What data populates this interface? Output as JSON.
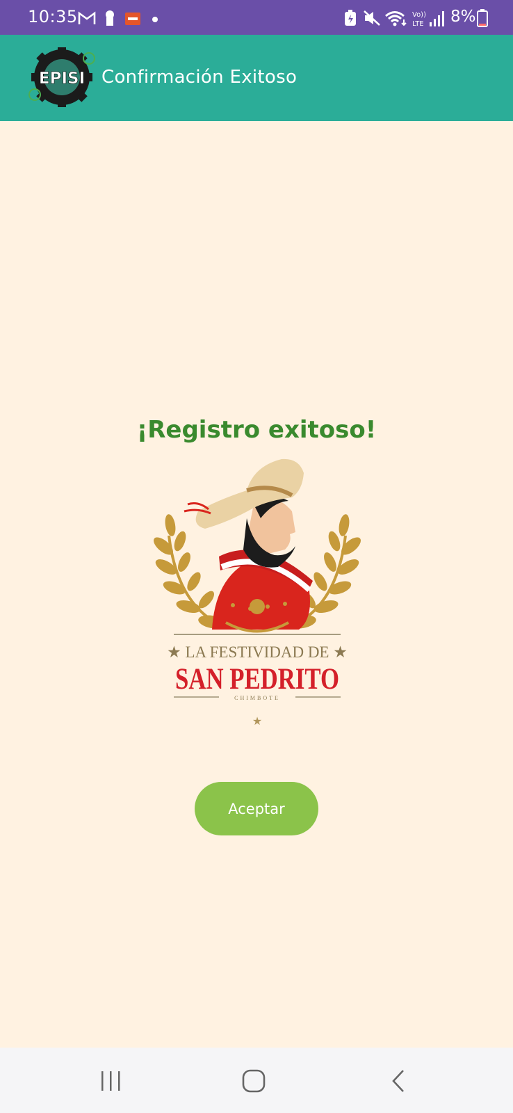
{
  "status_bar": {
    "time": "10:35",
    "battery": "8%",
    "icons": [
      "gmail-icon",
      "keyhole-icon",
      "app-notification-icon",
      "dot-icon",
      "battery-saver-icon",
      "mute-icon",
      "wifi-icon",
      "volte-icon",
      "signal-icon",
      "battery-icon"
    ]
  },
  "app_bar": {
    "logo_text": "EPISI",
    "title": "Confirmación Exitoso"
  },
  "content": {
    "success_title": "¡Registro exitoso!",
    "emblem": {
      "line1": "★ LA FESTIVIDAD DE ★",
      "line2": "SAN PEDRITO",
      "line3": "CHIMBOTE"
    },
    "accept_label": "Aceptar"
  },
  "nav_bar": {
    "buttons": [
      "recents-icon",
      "home-icon",
      "back-icon"
    ]
  },
  "colors": {
    "status_bar": "#6a4fa8",
    "app_bar": "#2bad98",
    "background": "#fff2e1",
    "title_green": "#3a8a2e",
    "button": "#8bc34a"
  }
}
